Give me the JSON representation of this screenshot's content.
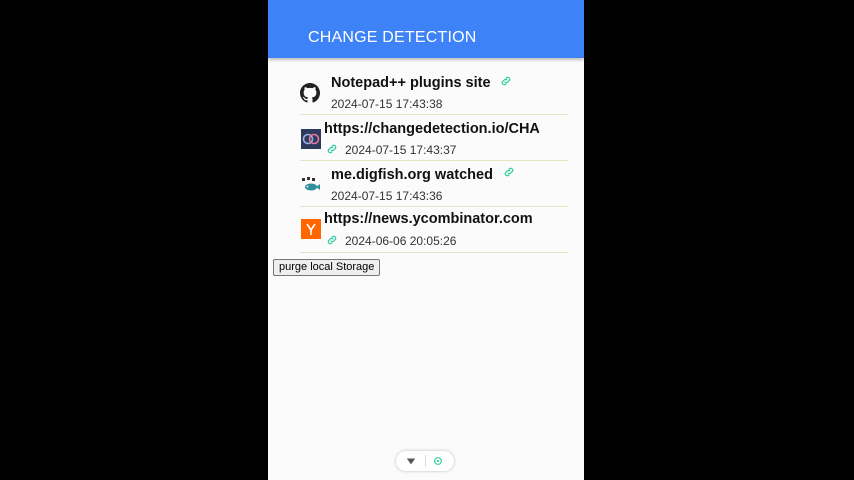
{
  "header": {
    "title": "CHANGE DETECTION"
  },
  "items": [
    {
      "name": "Notepad++ plugins site",
      "date": "2024-07-15 17:43:38",
      "icon": "github-icon"
    },
    {
      "name": "https://changedetection.io/CHANGELOG",
      "date": "2024-07-15 17:43:37",
      "icon": "changedetection-favicon"
    },
    {
      "name": "me.digfish.org watched",
      "date": "2024-07-15 17:43:36",
      "icon": "digfish-favicon"
    },
    {
      "name": "https://news.ycombinator.com",
      "date": "2024-06-06 20:05:26",
      "icon": "ycombinator-icon"
    }
  ],
  "buttons": {
    "purge": "purge local Storage"
  },
  "colors": {
    "header": "#3e82f7",
    "link": "#2ecc9a",
    "ycombinator": "#ff6600"
  }
}
